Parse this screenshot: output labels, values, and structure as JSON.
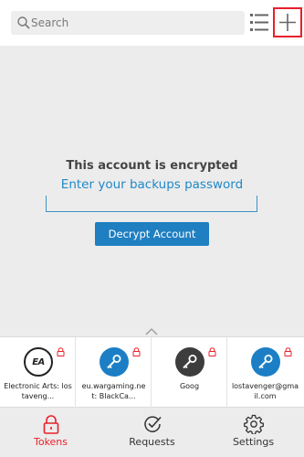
{
  "search": {
    "placeholder": "Search"
  },
  "main": {
    "title": "This account is encrypted",
    "subtitle": "Enter your backups password",
    "decrypt_label": "Decrypt Account"
  },
  "tokens": [
    {
      "name": "Electronic Arts: lostaveng...",
      "icon": "ea-logo"
    },
    {
      "name": "eu.wargaming.net: BlackCa...",
      "icon": "key-icon"
    },
    {
      "name": "Goog",
      "icon": "key-icon"
    },
    {
      "name": "lostavenger@gmail.com",
      "icon": "key-icon"
    }
  ],
  "nav": [
    {
      "label": "Tokens",
      "icon": "lock-icon",
      "active": true
    },
    {
      "label": "Requests",
      "icon": "check-circle-icon",
      "active": false
    },
    {
      "label": "Settings",
      "icon": "gear-icon",
      "active": false
    }
  ],
  "ea_logo_text": "EA",
  "colors": {
    "accent_red": "#e8202a",
    "accent_blue": "#1f7fc1",
    "link_blue": "#1f88c8"
  }
}
